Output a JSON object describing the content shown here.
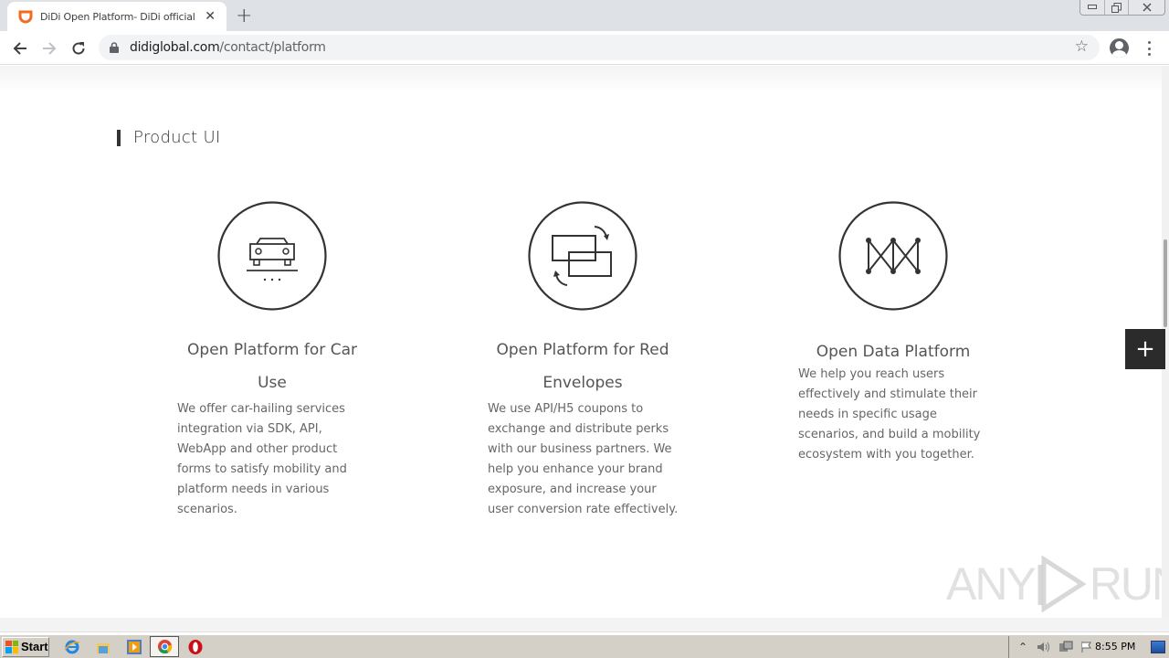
{
  "browser": {
    "tab_title": "DiDi Open Platform- DiDi official website",
    "tab_close": "✕",
    "new_tab": "+",
    "url_domain": "didiglobal.com",
    "url_path": "/contact/platform",
    "window_controls": {
      "minimize": "▭",
      "restore": "❐",
      "close": "✕"
    },
    "nav": {
      "back": "←",
      "forward": "→",
      "reload": "↻"
    },
    "bookmark_star": "☆",
    "brand_color": "#f26b21"
  },
  "page": {
    "section_title": "Product UI",
    "cards": [
      {
        "icon": "car-icon",
        "title": "Open Platform for Car Use",
        "description": "We offer car-hailing services integration via SDK, API, WebApp and other product forms to satisfy mobility and platform needs in various scenarios."
      },
      {
        "icon": "exchange-envelopes-icon",
        "title": "Open Platform for Red Envelopes",
        "description": "We use API/H5 coupons to exchange and distribute perks with our business partners. We help you enhance your brand exposure, and increase your user conversion rate effectively."
      },
      {
        "icon": "data-network-icon",
        "title": "Open Data Platform",
        "description": "We help you reach users effectively and stimulate their needs in specific usage scenarios, and build a mobility ecosystem with you together."
      }
    ],
    "float_button": "+"
  },
  "watermark": {
    "left": "ANY",
    "right": "RUN"
  },
  "taskbar": {
    "start_label": "Start",
    "clock": "8:55 PM",
    "tray_expand": "⌃"
  }
}
